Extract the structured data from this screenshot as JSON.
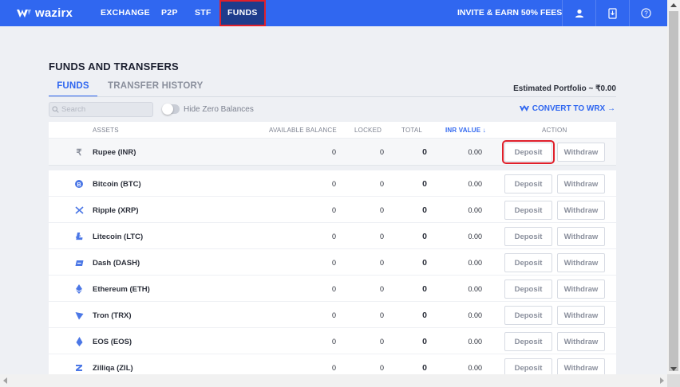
{
  "nav": {
    "logo": "wazirx",
    "items": [
      {
        "label": "EXCHANGE"
      },
      {
        "label": "P2P"
      },
      {
        "label": "STF"
      },
      {
        "label": "FUNDS"
      }
    ],
    "invite": "INVITE & EARN 50% FEES",
    "icons": [
      "user-icon",
      "download-app-icon",
      "help-icon"
    ]
  },
  "page": {
    "title": "FUNDS AND TRANSFERS",
    "tabs": [
      "FUNDS",
      "TRANSFER HISTORY"
    ],
    "estimated_portfolio": "Estimated Portfolio ~ ₹0.00",
    "search_placeholder": "Search",
    "hide_zero_label": "Hide Zero Balances",
    "convert_label": "CONVERT TO WRX →"
  },
  "table": {
    "headers": {
      "assets": "ASSETS",
      "available": "AVAILABLE BALANCE",
      "locked": "LOCKED",
      "total": "TOTAL",
      "inr_value": "INR VALUE ↓",
      "action": "ACTION"
    },
    "deposit_label": "Deposit",
    "withdraw_label": "Withdraw",
    "rows": [
      {
        "asset": "Rupee (INR)",
        "available": "0",
        "locked": "0",
        "total": "0",
        "inr": "0.00",
        "icon": "rupee-icon"
      },
      {
        "asset": "Bitcoin (BTC)",
        "available": "0",
        "locked": "0",
        "total": "0",
        "inr": "0.00",
        "icon": "bitcoin-icon"
      },
      {
        "asset": "Ripple (XRP)",
        "available": "0",
        "locked": "0",
        "total": "0",
        "inr": "0.00",
        "icon": "ripple-icon"
      },
      {
        "asset": "Litecoin (LTC)",
        "available": "0",
        "locked": "0",
        "total": "0",
        "inr": "0.00",
        "icon": "litecoin-icon"
      },
      {
        "asset": "Dash (DASH)",
        "available": "0",
        "locked": "0",
        "total": "0",
        "inr": "0.00",
        "icon": "dash-icon"
      },
      {
        "asset": "Ethereum (ETH)",
        "available": "0",
        "locked": "0",
        "total": "0",
        "inr": "0.00",
        "icon": "ethereum-icon"
      },
      {
        "asset": "Tron (TRX)",
        "available": "0",
        "locked": "0",
        "total": "0",
        "inr": "0.00",
        "icon": "tron-icon"
      },
      {
        "asset": "EOS (EOS)",
        "available": "0",
        "locked": "0",
        "total": "0",
        "inr": "0.00",
        "icon": "eos-icon"
      },
      {
        "asset": "Zilliqa (ZIL)",
        "available": "0",
        "locked": "0",
        "total": "0",
        "inr": "0.00",
        "icon": "zilliqa-icon"
      }
    ]
  },
  "colors": {
    "brand": "#3067f0",
    "nav_active": "#1e3c8c",
    "highlight": "#e0202b"
  }
}
